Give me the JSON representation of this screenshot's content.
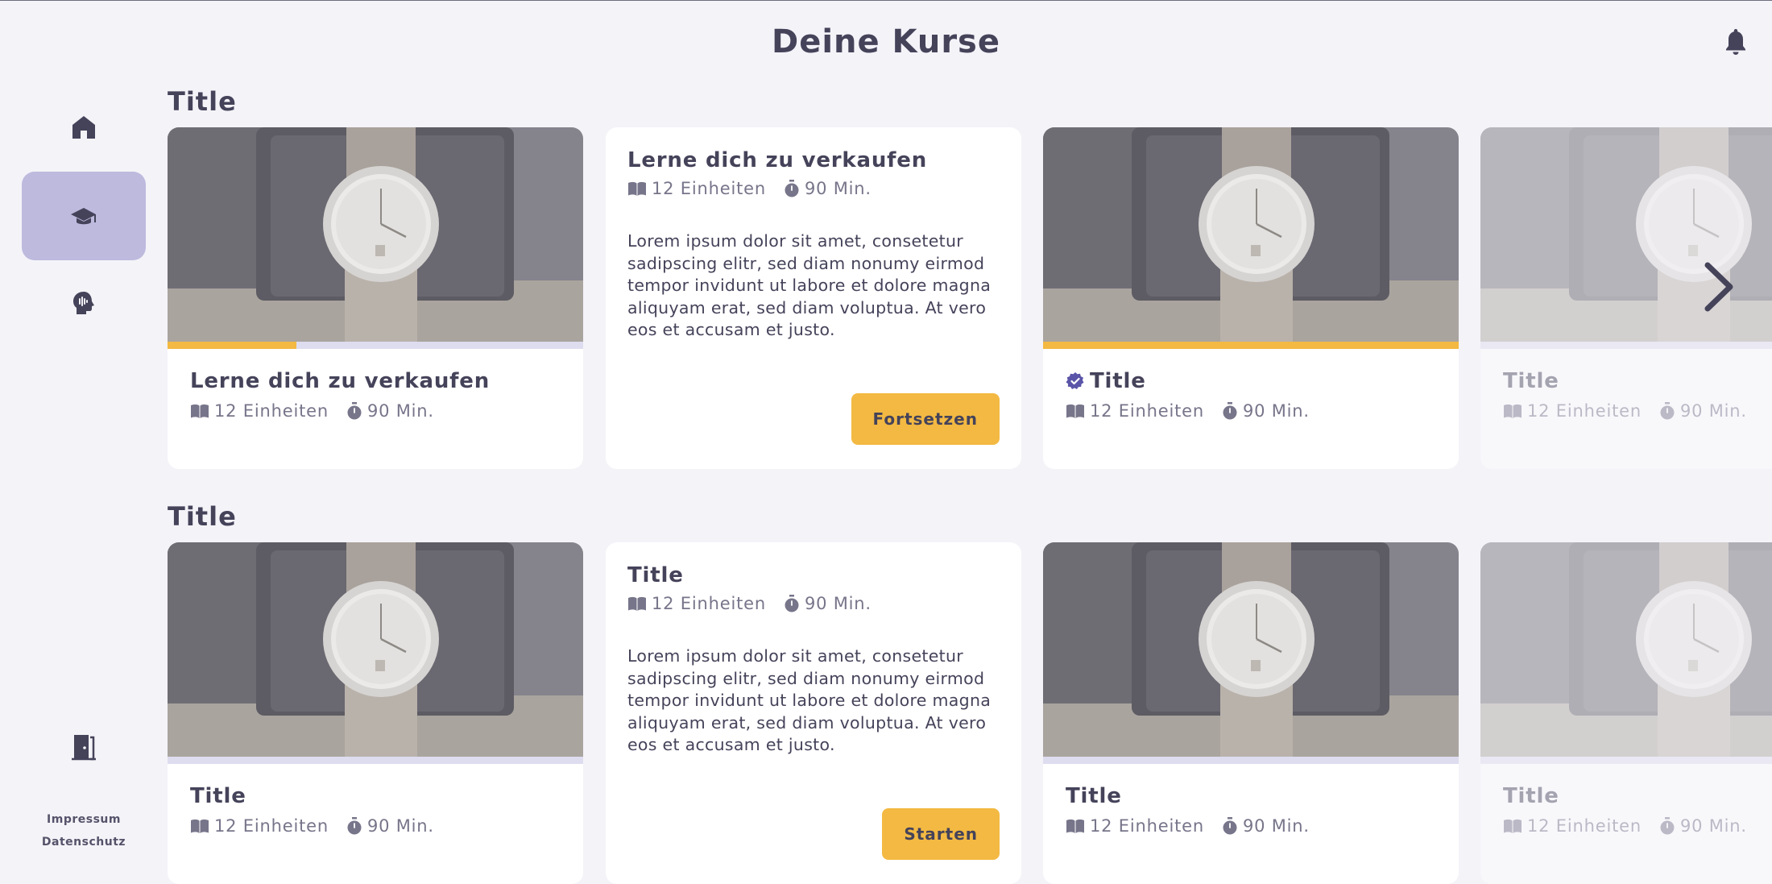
{
  "header": {
    "title": "Deine Kurse"
  },
  "sidebar": {
    "items": [
      {
        "name": "home",
        "icon": "home-icon",
        "active": false
      },
      {
        "name": "courses",
        "icon": "graduation-cap-icon",
        "active": true
      },
      {
        "name": "ai",
        "icon": "head-icon",
        "active": false
      }
    ],
    "logout_icon": "door-exit-icon",
    "footer": {
      "impressum": "Impressum",
      "datenschutz": "Datenschutz"
    }
  },
  "sections": [
    {
      "title": "Title",
      "cards": [
        {
          "title": "Lerne dich zu verkaufen",
          "units": "12 Einheiten",
          "duration": "90 Min.",
          "progress": 0.31
        },
        {
          "detail": true,
          "title": "Lerne dich zu verkaufen",
          "units": "12 Einheiten",
          "duration": "90 Min.",
          "description": "Lorem ipsum dolor sit amet, consetetur sadipscing elitr, sed diam nonumy eirmod tempor invidunt ut labore et dolore magna aliquyam erat, sed diam voluptua. At vero eos et accusam et justo.",
          "button": "Fortsetzen"
        },
        {
          "title": "Title",
          "units": "12 Einheiten",
          "duration": "90 Min.",
          "progress": 1.0,
          "verified": true
        },
        {
          "title": "Title",
          "units": "12 Einheiten",
          "duration": "90 Min.",
          "progress": 0.0,
          "faded": true
        }
      ]
    },
    {
      "title": "Title",
      "cards": [
        {
          "title": "Title",
          "units": "12 Einheiten",
          "duration": "90 Min.",
          "progress": 0.0
        },
        {
          "detail": true,
          "title": "Title",
          "units": "12 Einheiten",
          "duration": "90 Min.",
          "description": "Lorem ipsum dolor sit amet, consetetur sadipscing elitr, sed diam nonumy eirmod tempor invidunt ut labore et dolore magna aliquyam erat, sed diam voluptua. At vero eos et accusam et justo.",
          "button": "Starten"
        },
        {
          "title": "Title",
          "units": "12 Einheiten",
          "duration": "90 Min.",
          "progress": 0.0
        },
        {
          "title": "Title",
          "units": "12 Einheiten",
          "duration": "90 Min.",
          "progress": 0.0,
          "faded": true
        }
      ]
    }
  ],
  "colors": {
    "accent": "#f3b942",
    "active_nav": "#bdbade",
    "text": "#45435a",
    "muted": "#77758a",
    "verified": "#5a55a8"
  }
}
